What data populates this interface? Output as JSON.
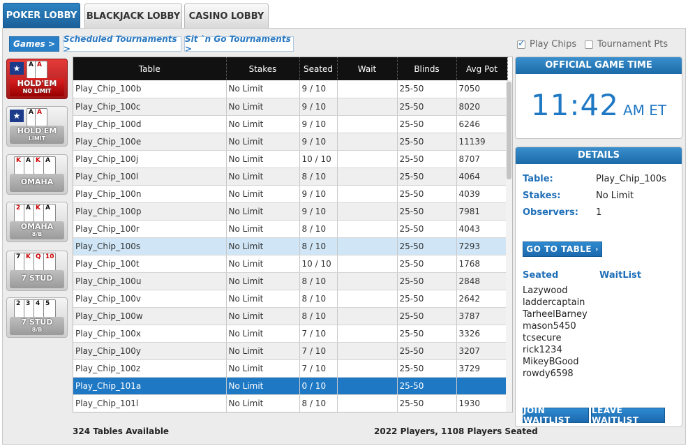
{
  "top_tabs": [
    "POKER LOBBY",
    "BLACKJACK LOBBY",
    "CASINO LOBBY"
  ],
  "sub_tabs": [
    "Games >",
    "Scheduled Tournaments >",
    "Sit `n Go Tournaments >"
  ],
  "options": {
    "play_chips": "Play Chips",
    "play_chips_checked": true,
    "tournament_pts": "Tournament Pts",
    "tournament_pts_checked": false
  },
  "games": [
    {
      "label": "HOLD'EM",
      "sub": "NO LIMIT",
      "icon": "holdem-no-limit-icon"
    },
    {
      "label": "HOLD'EM",
      "sub": "LIMIT",
      "icon": "holdem-limit-icon"
    },
    {
      "label": "OMAHA",
      "sub": "",
      "icon": "omaha-icon"
    },
    {
      "label": "OMAHA",
      "sub": "8/B",
      "icon": "omaha-8b-icon"
    },
    {
      "label": "7 STUD",
      "sub": "",
      "icon": "7-stud-icon"
    },
    {
      "label": "7 STUD",
      "sub": "8/B",
      "icon": "7-stud-8b-icon"
    }
  ],
  "table": {
    "columns": [
      "Table",
      "Stakes",
      "Seated",
      "Wait",
      "Blinds",
      "Avg Pot"
    ],
    "rows": [
      [
        "Play_Chip_100b",
        "No Limit",
        "9 / 10",
        "",
        "25-50",
        "7050"
      ],
      [
        "Play_Chip_100c",
        "No Limit",
        "9 / 10",
        "",
        "25-50",
        "8020"
      ],
      [
        "Play_Chip_100d",
        "No Limit",
        "9 / 10",
        "",
        "25-50",
        "6246"
      ],
      [
        "Play_Chip_100e",
        "No Limit",
        "9 / 10",
        "",
        "25-50",
        "11139"
      ],
      [
        "Play_Chip_100j",
        "No Limit",
        "10 / 10",
        "",
        "25-50",
        "8707"
      ],
      [
        "Play_Chip_100l",
        "No Limit",
        "8 / 10",
        "",
        "25-50",
        "4064"
      ],
      [
        "Play_Chip_100n",
        "No Limit",
        "9 / 10",
        "",
        "25-50",
        "4039"
      ],
      [
        "Play_Chip_100p",
        "No Limit",
        "9 / 10",
        "",
        "25-50",
        "7981"
      ],
      [
        "Play_Chip_100r",
        "No Limit",
        "8 / 10",
        "",
        "25-50",
        "4043"
      ],
      [
        "Play_Chip_100s",
        "No Limit",
        "8 / 10",
        "",
        "25-50",
        "7293"
      ],
      [
        "Play_Chip_100t",
        "No Limit",
        "10 / 10",
        "",
        "25-50",
        "1768"
      ],
      [
        "Play_Chip_100u",
        "No Limit",
        "8 / 10",
        "",
        "25-50",
        "2848"
      ],
      [
        "Play_Chip_100v",
        "No Limit",
        "8 / 10",
        "",
        "25-50",
        "2642"
      ],
      [
        "Play_Chip_100w",
        "No Limit",
        "8 / 10",
        "",
        "25-50",
        "3787"
      ],
      [
        "Play_Chip_100x",
        "No Limit",
        "7 / 10",
        "",
        "25-50",
        "3326"
      ],
      [
        "Play_Chip_100y",
        "No Limit",
        "7 / 10",
        "",
        "25-50",
        "3207"
      ],
      [
        "Play_Chip_100z",
        "No Limit",
        "7 / 10",
        "",
        "25-50",
        "3729"
      ],
      [
        "Play_Chip_101a",
        "No Limit",
        "0 / 10",
        "",
        "25-50",
        ""
      ],
      [
        "Play_Chip_101l",
        "No Limit",
        "8 / 10",
        "",
        "25-50",
        "1930"
      ]
    ],
    "selected_index": 9,
    "highlighted_index": 17
  },
  "footer": {
    "tables_available": "324 Tables Available",
    "players": "2022 Players, 1108 Players Seated"
  },
  "game_time": {
    "title": "OFFICIAL GAME TIME",
    "time": "11:42",
    "suffix": "AM ET"
  },
  "details": {
    "title": "DETAILS",
    "table_label": "Table:",
    "table_value": "Play_Chip_100s",
    "stakes_label": "Stakes:",
    "stakes_value": "No Limit",
    "observers_label": "Observers:",
    "observers_value": "1",
    "go_to_table": "GO TO TABLE",
    "seated_title": "Seated",
    "waitlist_title": "WaitList",
    "seated": [
      "Lazywood",
      "laddercaptain",
      "TarheelBarney",
      "mason5450",
      "tcsecure",
      "rick1234",
      "MikeyBGood",
      "rowdy6598"
    ],
    "join_waitlist": "JOIN WAITLIST",
    "leave_waitlist": "LEAVE WAITLIST"
  },
  "colors": {
    "accent": "#1f78c4",
    "header_bg": "#111111",
    "active_game": "#c62828"
  }
}
